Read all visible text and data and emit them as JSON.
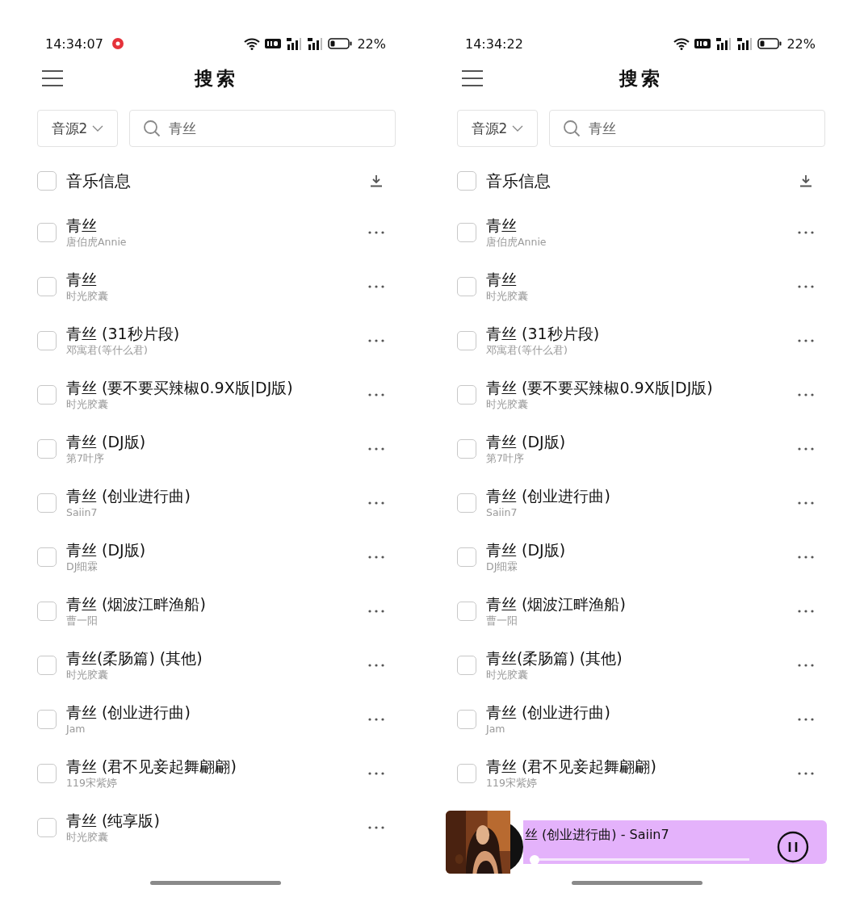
{
  "screens": [
    {
      "status_bar": {
        "time": "14:34:07",
        "app_notification": true,
        "battery": "22%"
      },
      "title": "搜索",
      "source_select": {
        "value": "音源2"
      },
      "search": {
        "value": "青丝"
      },
      "header": {
        "label": "音乐信息",
        "checked": false
      },
      "songs": [
        {
          "title": "青丝",
          "artist": "唐伯虎Annie",
          "checked": false
        },
        {
          "title": "青丝",
          "artist": "时光胶囊",
          "checked": false
        },
        {
          "title": "青丝 (31秒片段)",
          "artist": "邓寓君(等什么君)",
          "checked": false
        },
        {
          "title": "青丝 (要不要买辣椒0.9X版|DJ版)",
          "artist": "时光胶囊",
          "checked": false
        },
        {
          "title": "青丝 (DJ版)",
          "artist": "第7叶序",
          "checked": false
        },
        {
          "title": "青丝 (创业进行曲)",
          "artist": "Saiin7",
          "checked": false
        },
        {
          "title": "青丝 (DJ版)",
          "artist": "DJ细霖",
          "checked": false
        },
        {
          "title": "青丝 (烟波江畔渔船)",
          "artist": "曹一阳",
          "checked": false
        },
        {
          "title": "青丝(柔肠篇) (其他)",
          "artist": "时光胶囊",
          "checked": false
        },
        {
          "title": "青丝 (创业进行曲)",
          "artist": "Jam",
          "checked": false
        },
        {
          "title": "青丝 (君不见妾起舞翩翩)",
          "artist": "119宋紫婷",
          "checked": false
        },
        {
          "title": "青丝 (纯享版)",
          "artist": "时光胶囊",
          "checked": false
        }
      ]
    },
    {
      "status_bar": {
        "time": "14:34:22",
        "battery": "22%"
      },
      "title": "搜索",
      "source_select": {
        "value": "音源2"
      },
      "search": {
        "value": "青丝"
      },
      "header": {
        "label": "音乐信息",
        "checked": false
      },
      "songs": [
        {
          "title": "青丝",
          "artist": "唐伯虎Annie",
          "checked": false
        },
        {
          "title": "青丝",
          "artist": "时光胶囊",
          "checked": false
        },
        {
          "title": "青丝 (31秒片段)",
          "artist": "邓寓君(等什么君)",
          "checked": false
        },
        {
          "title": "青丝 (要不要买辣椒0.9X版|DJ版)",
          "artist": "时光胶囊",
          "checked": false
        },
        {
          "title": "青丝 (DJ版)",
          "artist": "第7叶序",
          "checked": false
        },
        {
          "title": "青丝 (创业进行曲)",
          "artist": "Saiin7",
          "checked": false
        },
        {
          "title": "青丝 (DJ版)",
          "artist": "DJ细霖",
          "checked": false
        },
        {
          "title": "青丝 (烟波江畔渔船)",
          "artist": "曹一阳",
          "checked": false
        },
        {
          "title": "青丝(柔肠篇) (其他)",
          "artist": "时光胶囊",
          "checked": false
        },
        {
          "title": "青丝 (创业进行曲)",
          "artist": "Jam",
          "checked": false
        },
        {
          "title": "青丝 (君不见妾起舞翩翩)",
          "artist": "119宋紫婷",
          "checked": false
        }
      ],
      "player": {
        "track": "丝 (创业进行曲) - Saiin7",
        "playing": true,
        "level": 0.0
      }
    }
  ]
}
